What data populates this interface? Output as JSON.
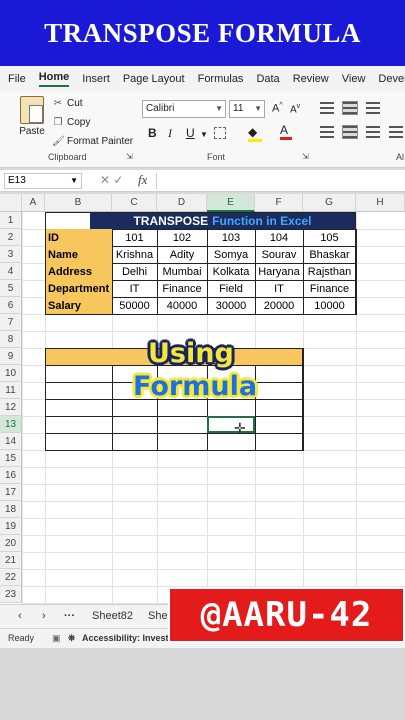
{
  "banner": {
    "title": "TRANSPOSE FORMULA"
  },
  "menu": {
    "items": [
      "File",
      "Home",
      "Insert",
      "Page Layout",
      "Formulas",
      "Data",
      "Review",
      "View",
      "Develo"
    ]
  },
  "ribbon": {
    "paste_label": "Paste",
    "cut_label": "Cut",
    "copy_label": "Copy",
    "format_painter_label": "Format Painter",
    "clipboard_label": "Clipboard",
    "font_name": "Calibri",
    "font_size": "11",
    "font_label": "Font",
    "bold": "B",
    "italic": "I",
    "underline": "U",
    "font_color_glyph": "A",
    "alignment_label": "Al"
  },
  "formula_bar": {
    "name_box": "E13",
    "fx": "fx",
    "value": ""
  },
  "columns": [
    "A",
    "B",
    "C",
    "D",
    "E",
    "F",
    "G",
    "H"
  ],
  "rows": [
    "1",
    "2",
    "3",
    "4",
    "5",
    "6",
    "7",
    "8",
    "9",
    "10",
    "11",
    "12",
    "13",
    "14",
    "15",
    "16",
    "17",
    "18",
    "19",
    "20",
    "21",
    "22",
    "23"
  ],
  "selected": {
    "column": "E",
    "row": "13"
  },
  "table": {
    "title_main": "TRANSPOSE",
    "title_rest": "Function in Excel",
    "rows": [
      {
        "label": "ID",
        "values": [
          "101",
          "102",
          "103",
          "104",
          "105"
        ]
      },
      {
        "label": "Name",
        "values": [
          "Krishna",
          "Adity",
          "Somya",
          "Sourav",
          "Bhaskar"
        ]
      },
      {
        "label": "Address",
        "values": [
          "Delhi",
          "Mumbai",
          "Kolkata",
          "Haryana",
          "Rajsthan"
        ]
      },
      {
        "label": "Department",
        "values": [
          "IT",
          "Finance",
          "Field",
          "IT",
          "Finance"
        ]
      },
      {
        "label": "Salary",
        "values": [
          "50000",
          "40000",
          "30000",
          "20000",
          "10000"
        ]
      }
    ]
  },
  "overlay": {
    "line1": "Using",
    "line2": "Formula"
  },
  "sheets": {
    "tab1": "Sheet82",
    "tab2": "Shee"
  },
  "status": {
    "ready": "Ready",
    "accessibility": "Accessibility: Investigat"
  },
  "watermark": "@AARU-42",
  "colors": {
    "banner": "#1a1ad6",
    "header_cell": "#f7c75e",
    "title_cell": "#1a2b5e",
    "watermark": "#e31b1b",
    "excel_green": "#1e7145"
  }
}
